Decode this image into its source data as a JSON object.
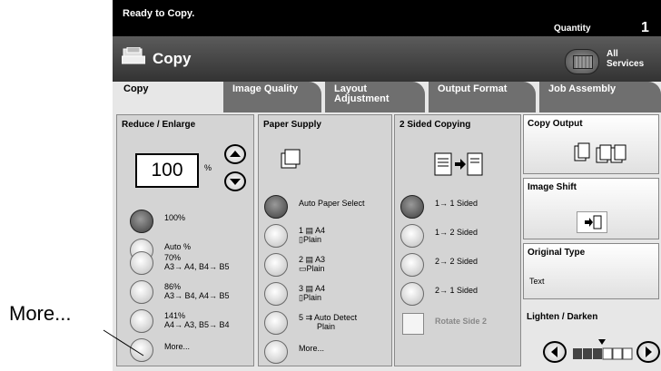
{
  "status": "Ready to Copy.",
  "quantity": {
    "label": "Quantity",
    "value": "1"
  },
  "app": {
    "title": "Copy",
    "all_services": [
      "All",
      "Services"
    ]
  },
  "tabs": [
    {
      "label": "Copy",
      "active": true
    },
    {
      "label": "Image Quality",
      "active": false
    },
    {
      "label": "Layout Adjustment",
      "active": false
    },
    {
      "label": "Output Format",
      "active": false
    },
    {
      "label": "Job Assembly",
      "active": false
    }
  ],
  "reduce_enlarge": {
    "title": "Reduce / Enlarge",
    "value": "100",
    "unit": "%",
    "options": [
      {
        "l1": "100%",
        "l2": "",
        "selected": true
      },
      {
        "l1": "Auto %",
        "l2": ""
      },
      {
        "l1": "70%",
        "l2": "A3→ A4, B4→ B5"
      },
      {
        "l1": "86%",
        "l2": "A3→ B4, A4→ B5"
      },
      {
        "l1": "141%",
        "l2": "A4→ A3, B5→ B4"
      },
      {
        "l1": "More...",
        "l2": ""
      }
    ]
  },
  "paper_supply": {
    "title": "Paper Supply",
    "options": [
      {
        "l1": "Auto Paper Select",
        "l2": "",
        "selected": true
      },
      {
        "l1": "1 ▤ A4",
        "l2": "▯Plain"
      },
      {
        "l1": "2 ▤ A3",
        "l2": "▭Plain"
      },
      {
        "l1": "3 ▤ A4",
        "l2": "▯Plain"
      },
      {
        "l1": "5 ⇉ Auto Detect",
        "l2": "Plain"
      },
      {
        "l1": "More...",
        "l2": ""
      }
    ]
  },
  "two_sided": {
    "title": "2 Sided Copying",
    "options": [
      {
        "l1": "1→ 1 Sided",
        "selected": true
      },
      {
        "l1": "1→ 2 Sided"
      },
      {
        "l1": "2→ 2 Sided"
      },
      {
        "l1": "2→ 1 Sided"
      }
    ],
    "rotate": "Rotate Side 2"
  },
  "right": {
    "copy_output": "Copy Output",
    "image_shift": "Image Shift",
    "original_type": "Original Type",
    "original_type_value": "Text",
    "lighten_darken": "Lighten / Darken"
  },
  "callout": "More..."
}
